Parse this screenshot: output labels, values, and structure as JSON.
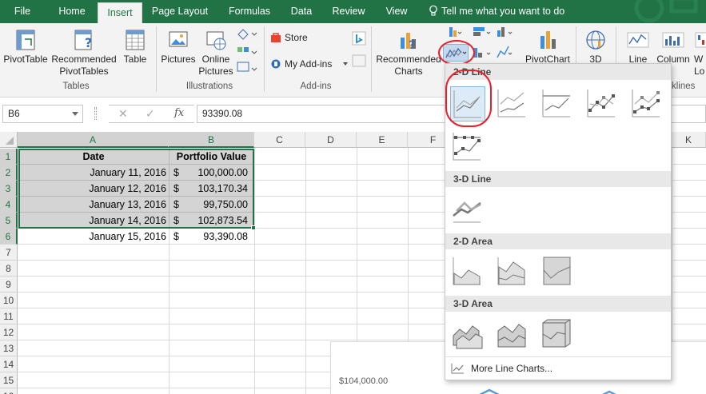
{
  "tabs": [
    "File",
    "Home",
    "Insert",
    "Page Layout",
    "Formulas",
    "Data",
    "Review",
    "View"
  ],
  "active_tab": "Insert",
  "tell_me": "Tell me what you want to do",
  "ribbon": {
    "pivottable": "PivotTable",
    "recommended_pivot_1": "Recommended",
    "recommended_pivot_2": "PivotTables",
    "table": "Table",
    "group_tables": "Tables",
    "pictures": "Pictures",
    "online_pictures_1": "Online",
    "online_pictures_2": "Pictures",
    "group_illustrations": "Illustrations",
    "store": "Store",
    "my_addins": "My Add-ins",
    "group_addins": "Add-ins",
    "recommended_charts_1": "Recommended",
    "recommended_charts_2": "Charts",
    "pivotchart": "PivotChart",
    "map_3d": "3D",
    "sparkline_line": "Line",
    "sparkline_column": "Column",
    "sparkline_winloss": "W",
    "sparkline_winloss_2": "Lo",
    "group_sparklines": "klines"
  },
  "formula_bar": {
    "name_box": "B6",
    "cancel": "✕",
    "enter": "✓",
    "fx": "fx",
    "value": "93390.08"
  },
  "columns": [
    "A",
    "B",
    "C",
    "D",
    "E",
    "F",
    "K"
  ],
  "rows": [
    "1",
    "2",
    "3",
    "4",
    "5",
    "6",
    "7",
    "8",
    "9",
    "10",
    "11",
    "12",
    "13",
    "14",
    "15",
    "16"
  ],
  "table": {
    "headers": [
      "Date",
      "Portfolio Value"
    ],
    "rows": [
      {
        "date": "January 11, 2016",
        "cur": "$",
        "value": "100,000.00"
      },
      {
        "date": "January 12, 2016",
        "cur": "$",
        "value": "103,170.34"
      },
      {
        "date": "January 13, 2016",
        "cur": "$",
        "value": "99,750.00"
      },
      {
        "date": "January 14, 2016",
        "cur": "$",
        "value": "102,873.54"
      },
      {
        "date": "January 15, 2016",
        "cur": "$",
        "value": "93,390.08"
      }
    ]
  },
  "chart_preview_label": "$104,000.00",
  "dropdown": {
    "section_2d_line": "2-D Line",
    "section_3d_line": "3-D Line",
    "section_2d_area": "2-D Area",
    "section_3d_area": "3-D Area",
    "more": "More Line Charts..."
  },
  "colors": {
    "brand": "#217346",
    "annotation": "#e8202a",
    "selection_fill": "#d2d2d2"
  }
}
